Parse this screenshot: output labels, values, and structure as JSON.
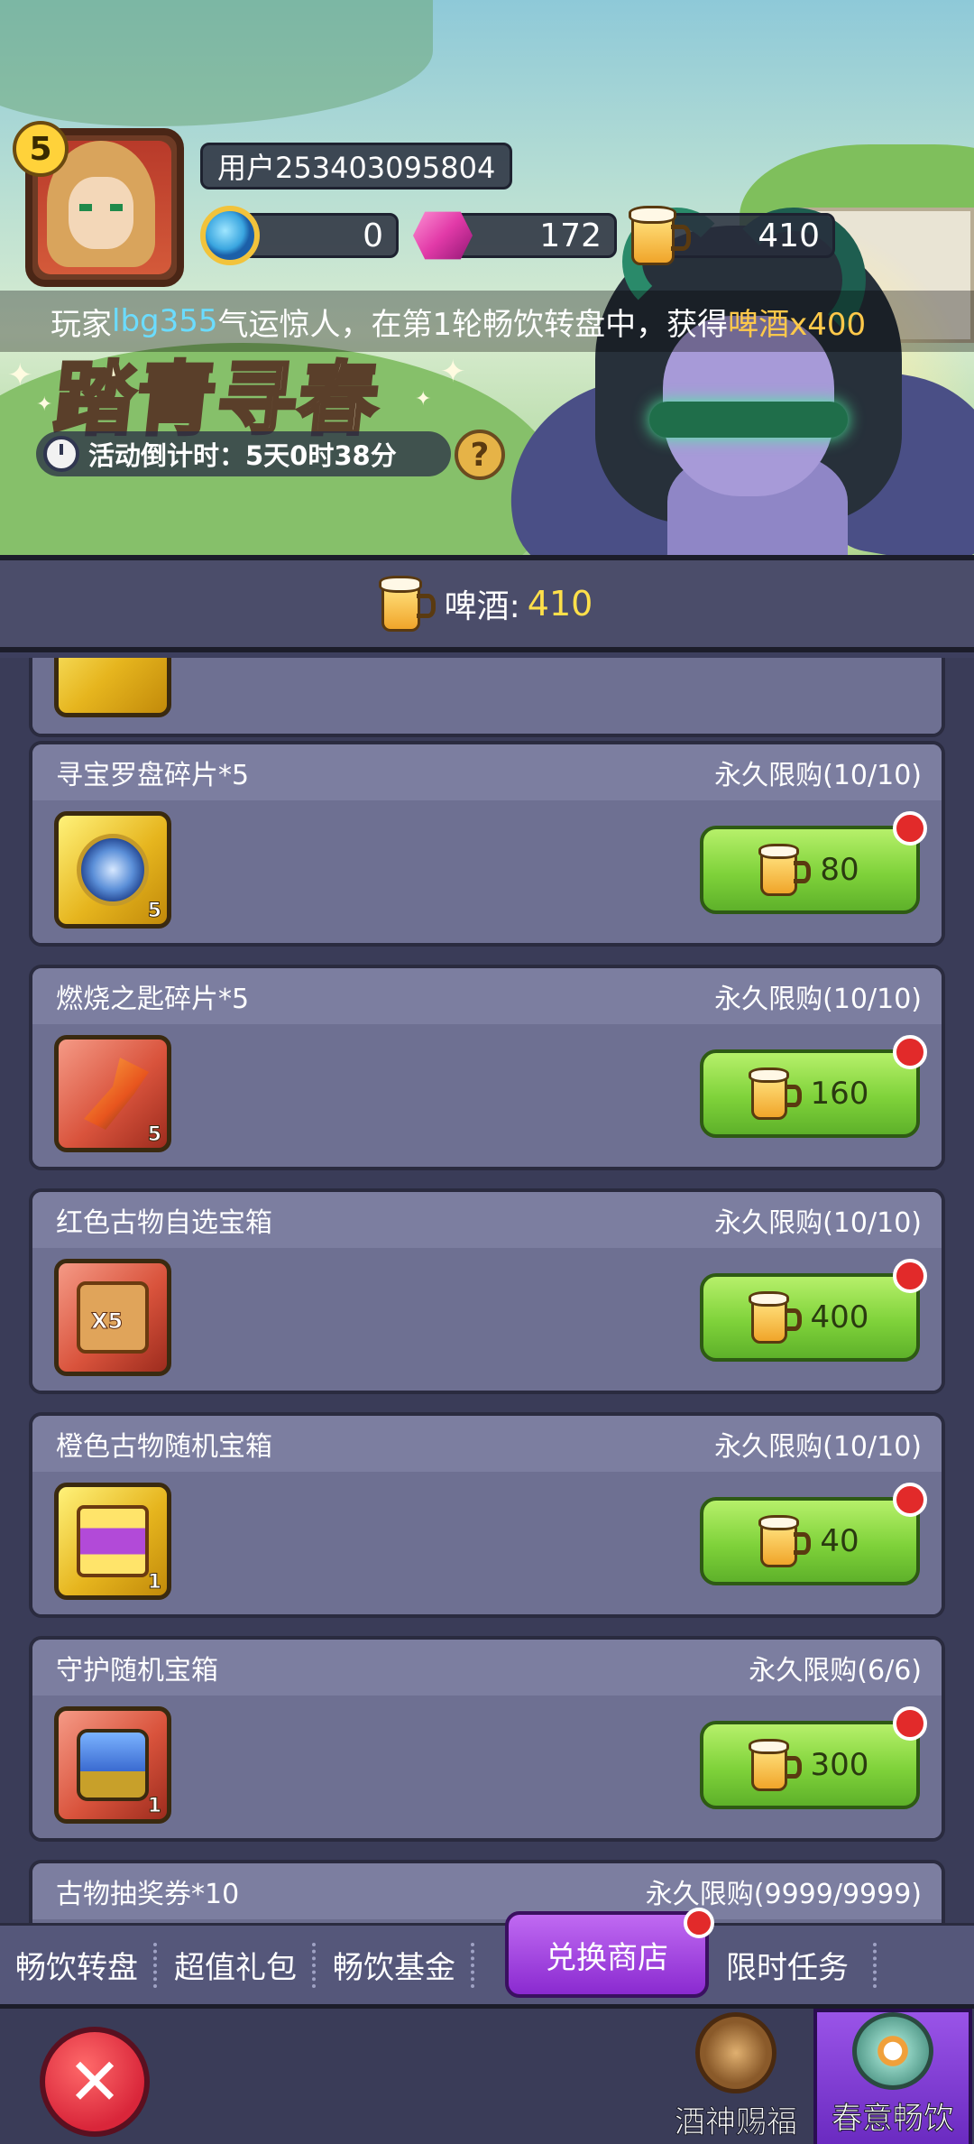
{
  "player": {
    "level": "5",
    "username": "用户253403095804",
    "coins": "0",
    "gems": "172",
    "beer": "410"
  },
  "event": {
    "title": "踏青寻春",
    "notice_prefix": "玩家",
    "notice_player": "lbg355",
    "notice_middle": "气运惊人，在第1轮畅饮转盘中，获得",
    "notice_reward": "啤酒x400",
    "countdown": "活动倒计时：5天0时38分",
    "help_label": "?"
  },
  "beer_bar": {
    "label": "啤酒:",
    "amount": "410"
  },
  "shop": {
    "items": [
      {
        "name": "寻宝罗盘碎片*5",
        "limit": "永久限购(10/10)",
        "price": "80",
        "qty": "5"
      },
      {
        "name": "燃烧之匙碎片*5",
        "limit": "永久限购(10/10)",
        "price": "160",
        "qty": "5"
      },
      {
        "name": "红色古物自选宝箱",
        "limit": "永久限购(10/10)",
        "price": "400",
        "qty": "",
        "art_label": "X5"
      },
      {
        "name": "橙色古物随机宝箱",
        "limit": "永久限购(10/10)",
        "price": "40",
        "qty": "1"
      },
      {
        "name": "守护随机宝箱",
        "limit": "永久限购(6/6)",
        "price": "300",
        "qty": "1"
      },
      {
        "name": "古物抽奖券*10",
        "limit": "永久限购(9999/9999)"
      }
    ]
  },
  "tabs": {
    "t1": "畅饮转盘",
    "t2": "超值礼包",
    "t3": "畅饮基金",
    "active": "兑换商店",
    "t5": "限时任务"
  },
  "bottom": {
    "close_label": "✕",
    "tab_blessing": "酒神赐福",
    "tab_drink": "春意畅饮"
  },
  "colors": {
    "buy_button": "#7fd23a",
    "active_tab": "#8a2ad0",
    "notice_name": "#6bdcff",
    "notice_reward": "#ffc94a",
    "beer_amount": "#ffe04a"
  }
}
